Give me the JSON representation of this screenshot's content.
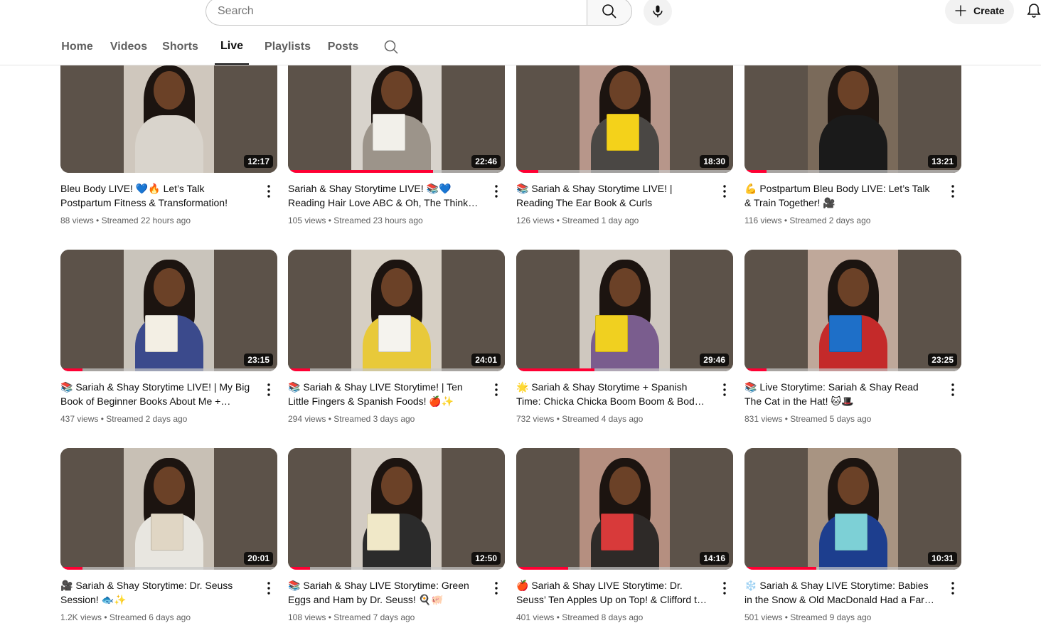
{
  "search": {
    "placeholder": "Search"
  },
  "header": {
    "create_label": "Create"
  },
  "tabs": [
    {
      "label": "Home",
      "active": false
    },
    {
      "label": "Videos",
      "active": false
    },
    {
      "label": "Shorts",
      "active": false
    },
    {
      "label": "Live",
      "active": true
    },
    {
      "label": "Playlists",
      "active": false
    },
    {
      "label": "Posts",
      "active": false
    }
  ],
  "videos": [
    {
      "title": "Bleu Body LIVE! 💙🔥 Let’s Talk Postpartum Fitness & Transformation!",
      "views": "88 views",
      "streamed": "Streamed 22 hours ago",
      "duration": "12:17",
      "progress": 0
    },
    {
      "title": "Sariah & Shay Storytime LIVE! 📚💙 Reading Hair Love ABC & Oh, The Thinks You Can Think!",
      "views": "105 views",
      "streamed": "Streamed 23 hours ago",
      "duration": "22:46",
      "progress": 0.67
    },
    {
      "title": "📚 Sariah & Shay Storytime LIVE! | Reading The Ear Book & Curls",
      "views": "126 views",
      "streamed": "Streamed 1 day ago",
      "duration": "18:30",
      "progress": 0.1
    },
    {
      "title": "💪 Postpartum Bleu Body LIVE: Let’s Talk & Train Together! 🎥",
      "views": "116 views",
      "streamed": "Streamed 2 days ago",
      "duration": "13:21",
      "progress": 0.1
    },
    {
      "title": "📚 Sariah & Shay Storytime LIVE! | My Big Book of Beginner Books About Me + Spanish Words!",
      "views": "437 views",
      "streamed": "Streamed 2 days ago",
      "duration": "23:15",
      "progress": 0.1
    },
    {
      "title": "📚 Sariah & Shay LIVE Storytime! | Ten Little Fingers & Spanish Foods! 🍎✨",
      "views": "294 views",
      "streamed": "Streamed 3 days ago",
      "duration": "24:01",
      "progress": 0.1
    },
    {
      "title": "🌟 Sariah & Shay Storytime + Spanish Time: Chicka Chicka Boom Boom & Body Parts! 🎉",
      "views": "732 views",
      "streamed": "Streamed 4 days ago",
      "duration": "29:46",
      "progress": 0.36
    },
    {
      "title": "📚 Live Storytime: Sariah & Shay Read The Cat in the Hat! 🐱🎩",
      "views": "831 views",
      "streamed": "Streamed 5 days ago",
      "duration": "23:25",
      "progress": 0.1
    },
    {
      "title": "🎥 Sariah & Shay Storytime: Dr. Seuss Session! 🐟✨",
      "views": "1.2K views",
      "streamed": "Streamed 6 days ago",
      "duration": "20:01",
      "progress": 0.1
    },
    {
      "title": "📚 Sariah & Shay LIVE Storytime: Green Eggs and Ham by Dr. Seuss! 🍳🐖",
      "views": "108 views",
      "streamed": "Streamed 7 days ago",
      "duration": "12:50",
      "progress": 0.1
    },
    {
      "title": "🍎 Sariah & Shay LIVE Storytime: Dr. Seuss’ Ten Apples Up on Top! & Clifford the Big Red Dog!",
      "views": "401 views",
      "streamed": "Streamed 8 days ago",
      "duration": "14:16",
      "progress": 0.24
    },
    {
      "title": "❄️ Sariah & Shay LIVE Storytime: Babies in the Snow & Old MacDonald Had a Farm! 📚",
      "views": "501 views",
      "streamed": "Streamed 9 days ago",
      "duration": "10:31",
      "progress": 0.33
    }
  ],
  "thumb_palette": [
    {
      "bg": "#cfc7bd",
      "shirt": "#d9d4cc",
      "book": ""
    },
    {
      "bg": "#d8d3cc",
      "shirt": "#9c948a",
      "book": "#f2f0ea"
    },
    {
      "bg": "#b7968a",
      "shirt": "#4a4744",
      "book": "#f4d21a"
    },
    {
      "bg": "#7a6a5a",
      "shirt": "#1a1a1a",
      "book": ""
    },
    {
      "bg": "#c9c4bb",
      "shirt": "#3b4a8c",
      "book": "#f3efe4"
    },
    {
      "bg": "#d6cfc4",
      "shirt": "#e8c93a",
      "book": "#f5f3ee"
    },
    {
      "bg": "#cfc8bf",
      "shirt": "#7a5d8e",
      "book": "#f0d020"
    },
    {
      "bg": "#bfa89a",
      "shirt": "#c42a2a",
      "book": "#1e6fc8"
    },
    {
      "bg": "#c8c0b5",
      "shirt": "#e8e6e0",
      "book": "#e0d6c4"
    },
    {
      "bg": "#d2cbc2",
      "shirt": "#2b2b2b",
      "book": "#f0e8c8"
    },
    {
      "bg": "#b58f80",
      "shirt": "#2e2a28",
      "book": "#d83a3a"
    },
    {
      "bg": "#a89482",
      "shirt": "#1d3e8e",
      "book": "#7dd0d6"
    }
  ]
}
